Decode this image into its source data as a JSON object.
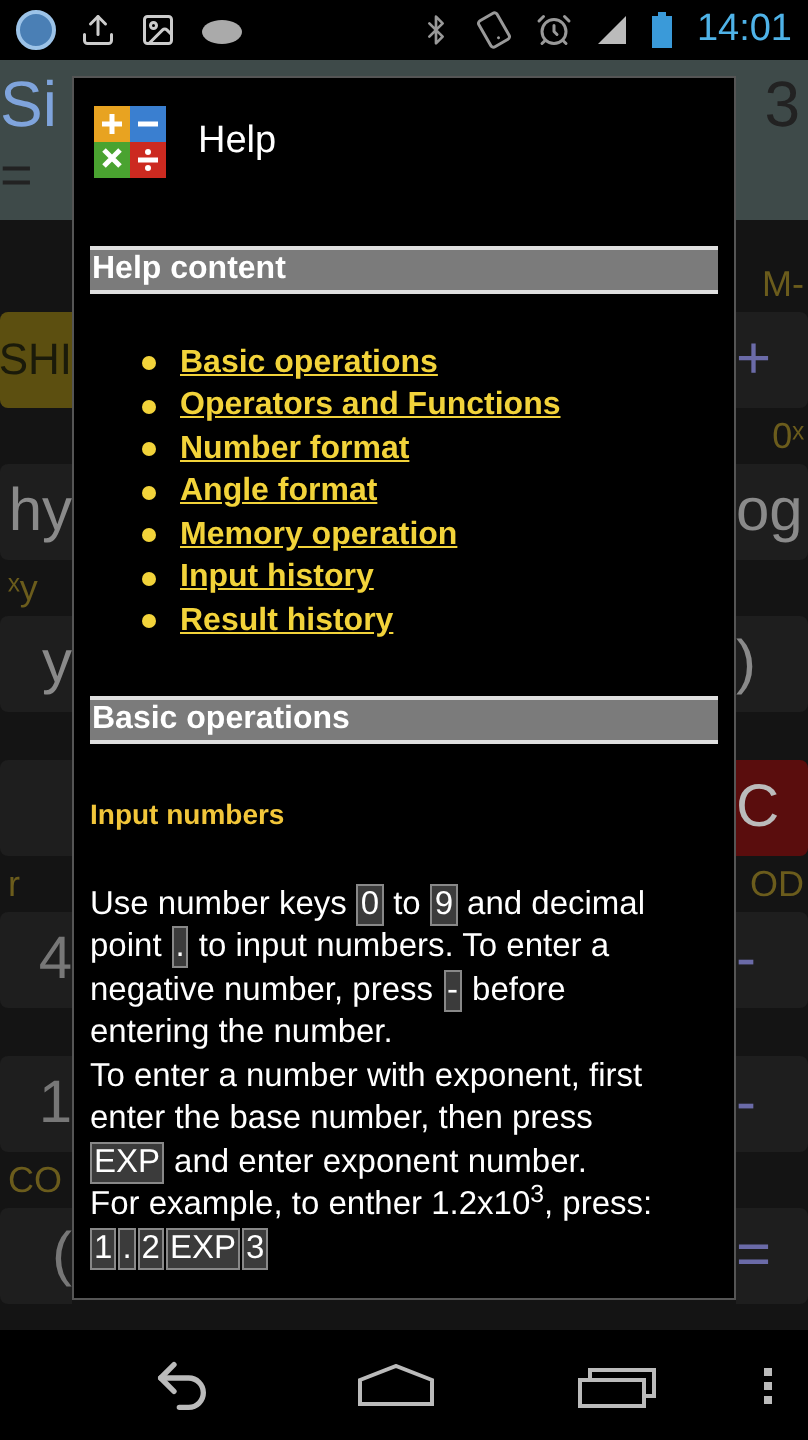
{
  "status_bar": {
    "time": "14:01"
  },
  "background": {
    "display": {
      "expression": "Si",
      "expression_end": "3",
      "equals": "="
    },
    "rows": [
      {
        "kind": "labels",
        "right": "M-"
      },
      {
        "kind": "keys",
        "left": {
          "text": "SHI",
          "kind": "shift"
        },
        "right": {
          "text": "+",
          "kind": "op"
        }
      },
      {
        "kind": "labels",
        "right": "0ˣ"
      },
      {
        "kind": "keys",
        "left": {
          "text": "hy",
          "kind": "fn"
        },
        "right": {
          "text": "og",
          "kind": "fn"
        }
      },
      {
        "kind": "labels",
        "left": "ˣy"
      },
      {
        "kind": "keys",
        "left": {
          "text": "y",
          "kind": "fn"
        },
        "right": {
          "text": ")",
          "kind": "fn"
        }
      },
      {
        "kind": "gap"
      },
      {
        "kind": "keys",
        "left": {
          "kind": "num"
        },
        "right": {
          "text": "C",
          "kind": "clear"
        }
      },
      {
        "kind": "labels",
        "left": "r",
        "right": "OD"
      },
      {
        "kind": "keys",
        "left": {
          "text": "4",
          "kind": "num"
        },
        "right": {
          "text": "-",
          "kind": "op"
        }
      },
      {
        "kind": "gap"
      },
      {
        "kind": "keys",
        "left": {
          "text": "1",
          "kind": "num"
        },
        "right": {
          "text": "-",
          "kind": "op"
        }
      },
      {
        "kind": "labels",
        "left": "CO"
      },
      {
        "kind": "keys",
        "left": {
          "text": "(",
          "kind": "num"
        },
        "right": {
          "text": "=",
          "kind": "op"
        }
      }
    ]
  },
  "dialog": {
    "title": "Help",
    "sections": [
      {
        "kind": "toc",
        "heading": "Help content",
        "links": [
          "Basic operations",
          "Operators and Functions",
          "Number format",
          "Angle format",
          "Memory operation",
          "Input history",
          "Result history"
        ]
      },
      {
        "kind": "article",
        "heading": "Basic operations",
        "subheading": "Input numbers",
        "lines": [
          [
            {
              "kind": "text",
              "text": "Use number keys"
            },
            {
              "kind": "key",
              "text": "0"
            },
            {
              "kind": "text",
              "text": "to"
            },
            {
              "kind": "key",
              "text": "9"
            },
            {
              "kind": "text",
              "text": "and decimal"
            }
          ],
          [
            {
              "kind": "text",
              "text": "point"
            },
            {
              "kind": "key",
              "text": "."
            },
            {
              "kind": "text",
              "text": "to input numbers. To enter a"
            }
          ],
          [
            {
              "kind": "text",
              "text": "negative number, press"
            },
            {
              "kind": "key",
              "text": "-"
            },
            {
              "kind": "text",
              "text": "before"
            }
          ],
          [
            {
              "kind": "text",
              "text": "entering the number."
            }
          ],
          [
            {
              "kind": "text",
              "text": "To enter a number with exponent, first"
            }
          ],
          [
            {
              "kind": "text",
              "text": "enter the base number, then press"
            }
          ],
          [
            {
              "kind": "key",
              "text": "EXP"
            },
            {
              "kind": "text",
              "text": "and enter exponent number."
            }
          ],
          [
            {
              "kind": "text",
              "text": "For example, to enther 1.2x10$^{3}$, press:"
            }
          ],
          [
            {
              "kind": "key",
              "text": "1"
            },
            {
              "kind": "key",
              "text": "."
            },
            {
              "kind": "key",
              "text": "2"
            },
            {
              "kind": "key",
              "text": "EXP"
            },
            {
              "kind": "key",
              "text": "3"
            }
          ]
        ]
      }
    ]
  }
}
